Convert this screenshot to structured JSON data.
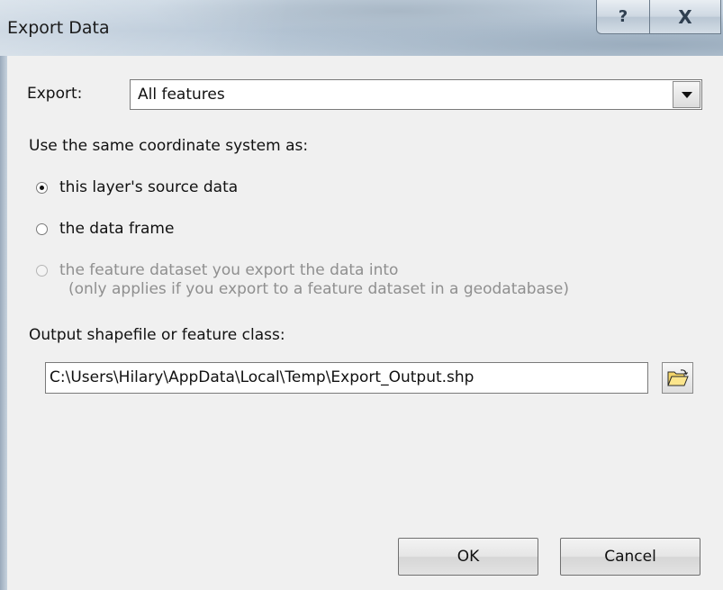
{
  "window": {
    "title": "Export Data",
    "help_glyph": "?",
    "close_glyph": "X"
  },
  "export": {
    "label": "Export:",
    "selected": "All features"
  },
  "coordinate": {
    "heading": "Use the same coordinate system as:",
    "options": [
      {
        "label": "this layer's source data",
        "checked": true,
        "disabled": false
      },
      {
        "label": "the data frame",
        "checked": false,
        "disabled": false
      },
      {
        "label": "the feature dataset you export the data into",
        "note": "(only applies if you export to a feature dataset in a geodatabase)",
        "checked": false,
        "disabled": true
      }
    ]
  },
  "output": {
    "label": "Output shapefile or feature class:",
    "path": "C:\\Users\\Hilary\\AppData\\Local\\Temp\\Export_Output.shp",
    "browse_icon": "open-folder-icon"
  },
  "buttons": {
    "ok": "OK",
    "cancel": "Cancel"
  }
}
